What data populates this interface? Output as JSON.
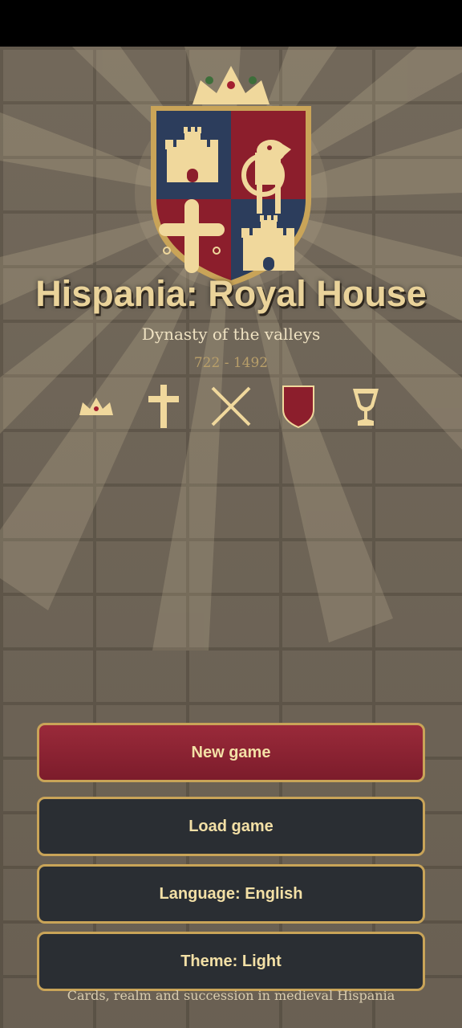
{
  "app": {
    "title": "Hispania: Royal House",
    "subtitle": "Dynasty of the valleys",
    "years": "722 - 1492"
  },
  "crest": {
    "quarters": [
      "castle",
      "lion",
      "cross",
      "castle"
    ],
    "colors": {
      "blue": "#2c3d5c",
      "red": "#8c1e2c",
      "gold": "#f0d89c",
      "border": "#c9a458"
    }
  },
  "symbols": [
    "crown-icon",
    "cross-icon",
    "crossed-swords-icon",
    "shield-icon",
    "chalice-icon"
  ],
  "menu": {
    "new_game": "New game",
    "load_game": "Load game",
    "language": "Language:  English",
    "theme": "Theme:  Light"
  },
  "footer": "Cards, realm and succession in medieval Hispania",
  "colors": {
    "accent": "#c9a458",
    "primary_button": "#8c2233",
    "secondary_button": "#2a2e33",
    "background": "#6f6557"
  }
}
